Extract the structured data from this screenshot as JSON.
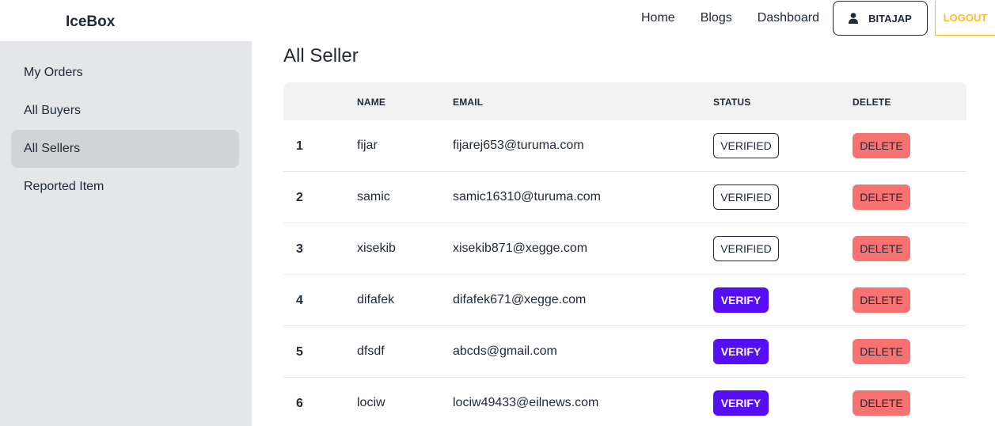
{
  "brand": "IceBox",
  "nav": {
    "links": [
      "Home",
      "Blogs",
      "Dashboard"
    ],
    "user_label": "BITAJAP",
    "logout_label": "LOGOUT"
  },
  "sidebar": {
    "items": [
      {
        "label": "My Orders",
        "active": false
      },
      {
        "label": "All Buyers",
        "active": false
      },
      {
        "label": "All Sellers",
        "active": true
      },
      {
        "label": "Reported Item",
        "active": false
      }
    ]
  },
  "main": {
    "title": "All Seller",
    "columns": [
      "",
      "NAME",
      "EMAIL",
      "STATUS",
      "DELETE"
    ],
    "rows": [
      {
        "num": "1",
        "name": "fijar",
        "email": "fijarej653@turuma.com",
        "status": "VERIFIED",
        "action": "DELETE"
      },
      {
        "num": "2",
        "name": "samic",
        "email": "samic16310@turuma.com",
        "status": "VERIFIED",
        "action": "DELETE"
      },
      {
        "num": "3",
        "name": "xisekib",
        "email": "xisekib871@xegge.com",
        "status": "VERIFIED",
        "action": "DELETE"
      },
      {
        "num": "4",
        "name": "difafek",
        "email": "difafek671@xegge.com",
        "status": "VERIFY",
        "action": "DELETE"
      },
      {
        "num": "5",
        "name": "dfsdf",
        "email": "abcds@gmail.com",
        "status": "VERIFY",
        "action": "DELETE"
      },
      {
        "num": "6",
        "name": "lociw",
        "email": "lociw49433@eilnews.com",
        "status": "VERIFY",
        "action": "DELETE"
      }
    ]
  },
  "colors": {
    "primary": "#570df8",
    "error": "#f87272",
    "warning": "#fbbd23",
    "sidebar_bg": "#e5e6e9",
    "active_item_bg": "#d2d3d8"
  },
  "icons": {
    "user_button": "user-icon"
  }
}
